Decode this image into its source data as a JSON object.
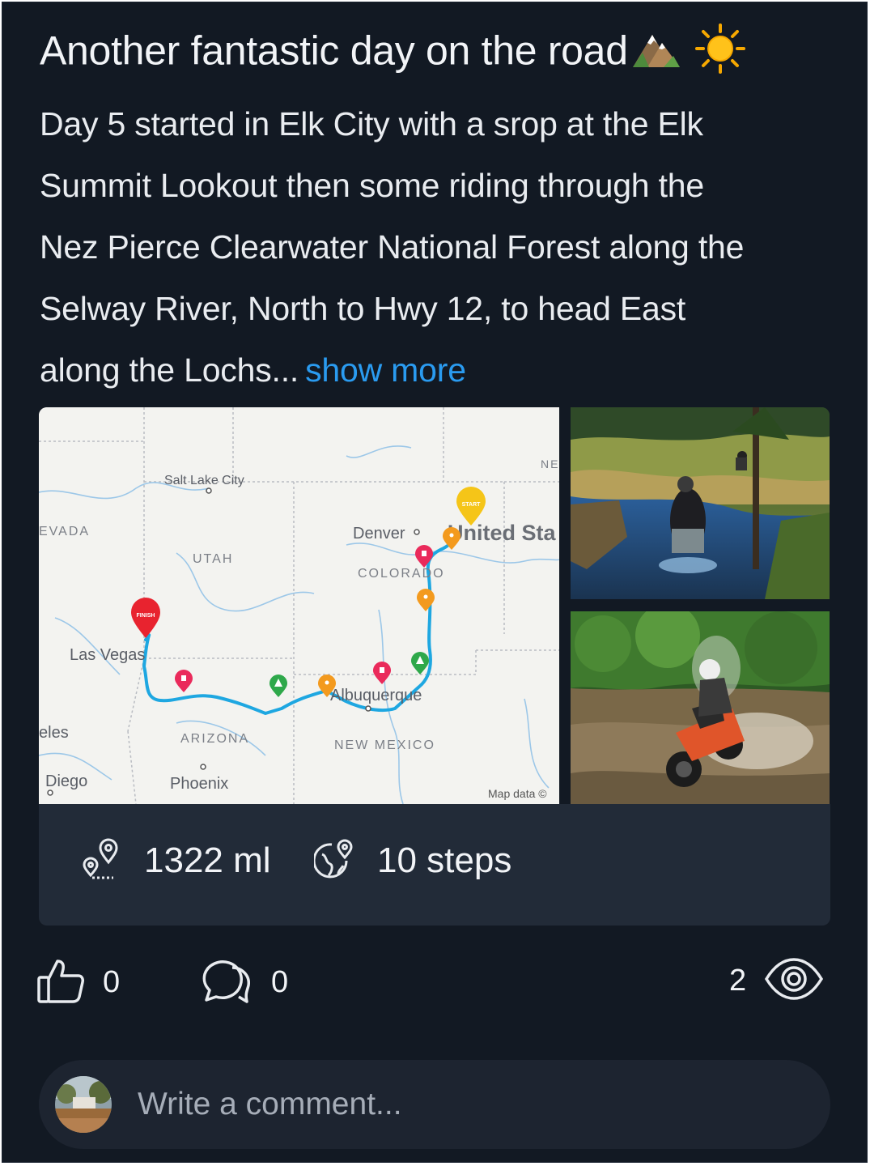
{
  "post": {
    "title": "Another fantastic day on the road",
    "title_emojis": [
      "mountain-icon",
      "sun-icon"
    ],
    "body_lines": [
      "Day 5 started in Elk City with a srop at the Elk",
      "Summit Lookout then some riding through the",
      "Nez Pierce Clearwater National Forest along the",
      "Selway River, North to Hwy 12, to head East",
      "along the Lochs..."
    ],
    "show_more": "show more"
  },
  "map": {
    "labels": {
      "salt_lake_city": "Salt Lake City",
      "nevada": "EVADA",
      "utah": "UTAH",
      "denver": "Denver",
      "united_states": "United Sta",
      "colorado": "COLORADO",
      "las_vegas": "Las Vegas",
      "arizona": "ARIZONA",
      "albuquerque": "Albuquerque",
      "new_mexico": "NEW MEXICO",
      "los_angeles": "eles",
      "san_diego": "Diego",
      "phoenix": "Phoenix",
      "ne": "NE",
      "attribution": "Map data ©"
    },
    "markers": {
      "start": "START",
      "finish": "FINISH"
    },
    "route_color": "#1ea7e1"
  },
  "stats": {
    "distance": "1322 ml",
    "steps": "10 steps"
  },
  "actions": {
    "likes": "0",
    "comments": "0",
    "views": "2"
  },
  "comment": {
    "placeholder": "Write a comment..."
  },
  "colors": {
    "background": "#121923",
    "accent": "#2a9bf0",
    "stats_bg": "#222b38"
  }
}
